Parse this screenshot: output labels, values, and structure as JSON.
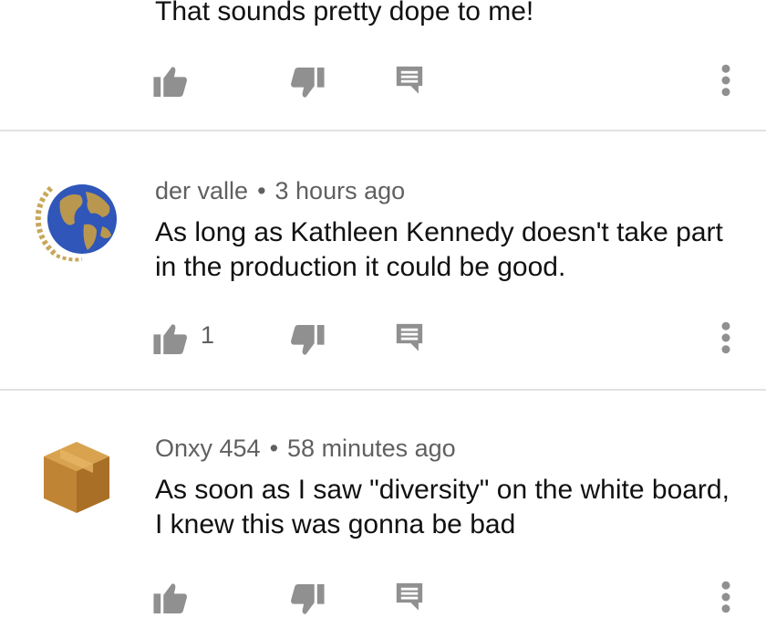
{
  "comments": [
    {
      "author": "",
      "time": "",
      "text": "That sounds pretty dope to me!",
      "likes": "",
      "avatar_icon": "partial-avatar-icon"
    },
    {
      "author": "der valle",
      "time": "3 hours ago",
      "text": "As long as Kathleen Kennedy doesn't take part in the production it could be good.",
      "likes": "1",
      "avatar_icon": "globe-laurel-icon"
    },
    {
      "author": "Onxy 454",
      "time": "58 minutes ago",
      "text": "As soon as I saw \"diversity\" on the white board, I knew this was gonna be bad",
      "likes": "",
      "avatar_icon": "cardboard-box-icon"
    }
  ],
  "separator": "•",
  "icons": {
    "like": "thumbs-up-icon",
    "dislike": "thumbs-down-icon",
    "reply": "reply-comment-icon",
    "more": "more-vertical-icon"
  },
  "colors": {
    "icon": "#909090",
    "meta_text": "#606060",
    "divider": "#e2e2e2"
  }
}
